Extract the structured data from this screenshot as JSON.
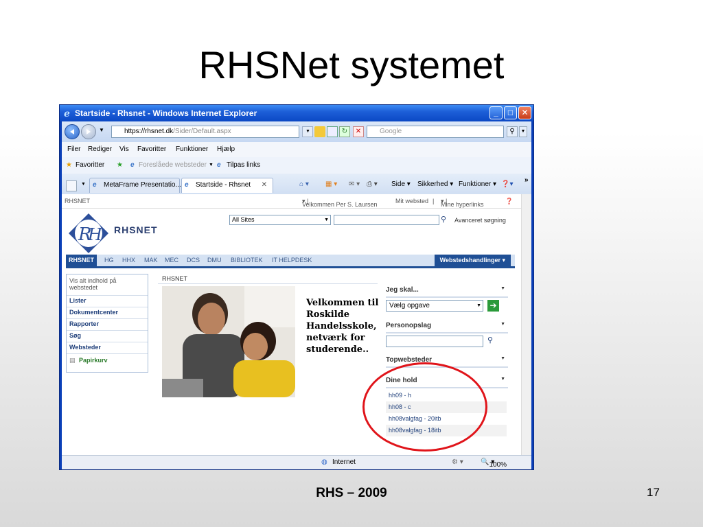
{
  "slide": {
    "title": "RHSNet systemet",
    "footer": "RHS – 2009",
    "page_number": "17"
  },
  "window": {
    "title": "Startside - Rhsnet - Windows Internet Explorer",
    "url_prefix": "https://",
    "url_host": "rhsnet.dk",
    "url_path": "/Sider/Default.aspx",
    "search_placeholder": "Google"
  },
  "menu": [
    "Filer",
    "Rediger",
    "Vis",
    "Favoritter",
    "Funktioner",
    "Hjælp"
  ],
  "favbar": {
    "favorites": "Favoritter",
    "suggested": "Foreslåede websteder",
    "tips": "Tilpas links"
  },
  "tabs": [
    {
      "label": "MetaFrame Presentatio..."
    },
    {
      "label": "Startside - Rhsnet"
    }
  ],
  "commands": {
    "side": "Side",
    "sikkerhed": "Sikkerhed",
    "funktioner": "Funktioner"
  },
  "sharepoint": {
    "site_label": "RHSNET",
    "welcome_user": "Velkommen Per S. Laursen",
    "my_site": "Mit websted",
    "my_links": "Mine hyperlinks",
    "logo_text": "RHSNET",
    "scope_select": "All Sites",
    "advanced_search": "Avanceret søgning",
    "nav_tabs": [
      "RHSNET",
      "HG",
      "HHX",
      "MAK",
      "MEC",
      "DCS",
      "DMU",
      "BIBLIOTEK",
      "IT HELPDESK"
    ],
    "site_actions": "Webstedshandlinger",
    "quicklaunch": {
      "view_all": "Vis alt indhold på webstedet",
      "items": [
        "Lister",
        "Dokumentcenter",
        "Rapporter",
        "Søg",
        "Websteder"
      ],
      "recycle": "Papirkurv"
    },
    "page_header": "RHSNET",
    "welcome_text": "Velkommen til Roskilde Handelsskole, netværk for studerende..",
    "webparts": {
      "jeg_skal": "Jeg skal...",
      "opgave_select": "Vælg opgave",
      "personopslag": "Personopslag",
      "topwebsteder": "Topwebsteder",
      "dine_hold": "Dine hold",
      "hold_items": [
        "hh09 - h",
        "hh08 - c",
        "hh08valgfag - 20itb",
        "hh08valgfag - 18itb"
      ]
    }
  },
  "status": {
    "zone": "Internet",
    "zoom": "100%"
  }
}
